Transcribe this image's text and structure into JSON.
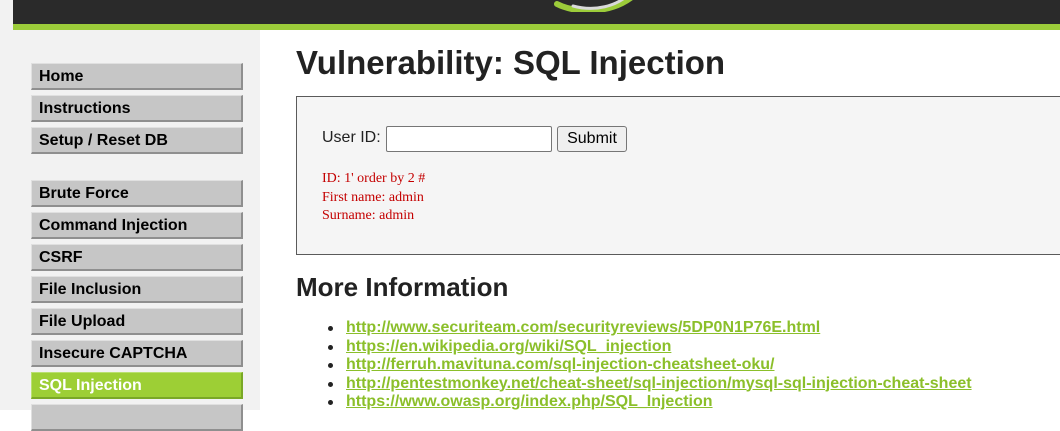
{
  "sidebar": {
    "items": [
      {
        "label": "Home"
      },
      {
        "label": "Instructions"
      },
      {
        "label": "Setup / Reset DB"
      },
      {
        "label": "Brute Force"
      },
      {
        "label": "Command Injection"
      },
      {
        "label": "CSRF"
      },
      {
        "label": "File Inclusion"
      },
      {
        "label": "File Upload"
      },
      {
        "label": "Insecure CAPTCHA"
      },
      {
        "label": "SQL Injection",
        "active": true
      }
    ]
  },
  "main": {
    "title": "Vulnerability: SQL Injection",
    "form": {
      "user_id_label": "User ID:",
      "user_id_value": "",
      "submit_label": "Submit"
    },
    "result": {
      "id_line": "ID: 1' order by 2 #",
      "first_name_line": "First name: admin",
      "surname_line": "Surname: admin"
    },
    "more_info": {
      "title": "More Information",
      "links": [
        "http://www.securiteam.com/securityreviews/5DP0N1P76E.html",
        "https://en.wikipedia.org/wiki/SQL_injection",
        "http://ferruh.mavituna.com/sql-injection-cheatsheet-oku/",
        "http://pentestmonkey.net/cheat-sheet/sql-injection/mysql-sql-injection-cheat-sheet",
        "https://www.owasp.org/index.php/SQL_Injection"
      ]
    }
  },
  "colors": {
    "accent": "#9dcf35",
    "link": "#8bbf2a",
    "result_text": "#c40000",
    "header": "#2a2a2a"
  }
}
